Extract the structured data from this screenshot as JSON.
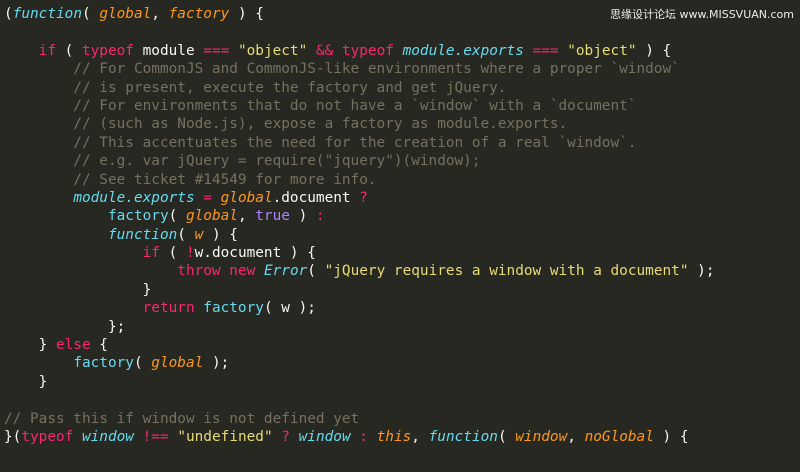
{
  "watermark": "思缘设计论坛 www.MISSVUAN.com",
  "lines": [
    [
      {
        "t": "(",
        "c": "plain"
      },
      {
        "t": "function",
        "c": "fn"
      },
      {
        "t": "( ",
        "c": "plain"
      },
      {
        "t": "global",
        "c": "param"
      },
      {
        "t": ", ",
        "c": "plain"
      },
      {
        "t": "factory",
        "c": "param"
      },
      {
        "t": " ) {",
        "c": "plain"
      }
    ],
    [],
    [
      {
        "t": "    ",
        "c": "plain"
      },
      {
        "t": "if",
        "c": "kw"
      },
      {
        "t": " ( ",
        "c": "plain"
      },
      {
        "t": "typeof",
        "c": "kw"
      },
      {
        "t": " module ",
        "c": "plain"
      },
      {
        "t": "===",
        "c": "op"
      },
      {
        "t": " ",
        "c": "plain"
      },
      {
        "t": "\"object\"",
        "c": "str"
      },
      {
        "t": " ",
        "c": "plain"
      },
      {
        "t": "&&",
        "c": "op"
      },
      {
        "t": " ",
        "c": "plain"
      },
      {
        "t": "typeof",
        "c": "kw"
      },
      {
        "t": " ",
        "c": "plain"
      },
      {
        "t": "module.exports",
        "c": "fn"
      },
      {
        "t": " ",
        "c": "plain"
      },
      {
        "t": "===",
        "c": "op"
      },
      {
        "t": " ",
        "c": "plain"
      },
      {
        "t": "\"object\"",
        "c": "str"
      },
      {
        "t": " ) {",
        "c": "plain"
      }
    ],
    [
      {
        "t": "        // For CommonJS and CommonJS-like environments where a proper `window`",
        "c": "cmt"
      }
    ],
    [
      {
        "t": "        // is present, execute the factory and get jQuery.",
        "c": "cmt"
      }
    ],
    [
      {
        "t": "        // For environments that do not have a `window` with a `document`",
        "c": "cmt"
      }
    ],
    [
      {
        "t": "        // (such as Node.js), expose a factory as module.exports.",
        "c": "cmt"
      }
    ],
    [
      {
        "t": "        // This accentuates the need for the creation of a real `window`.",
        "c": "cmt"
      }
    ],
    [
      {
        "t": "        // e.g. var jQuery = require(\"jquery\")(window);",
        "c": "cmt"
      }
    ],
    [
      {
        "t": "        // See ticket #14549 for more info.",
        "c": "cmt"
      }
    ],
    [
      {
        "t": "        ",
        "c": "plain"
      },
      {
        "t": "module.exports",
        "c": "fn"
      },
      {
        "t": " ",
        "c": "plain"
      },
      {
        "t": "=",
        "c": "op"
      },
      {
        "t": " ",
        "c": "plain"
      },
      {
        "t": "global",
        "c": "param"
      },
      {
        "t": ".document ",
        "c": "plain"
      },
      {
        "t": "?",
        "c": "op"
      }
    ],
    [
      {
        "t": "            ",
        "c": "plain"
      },
      {
        "t": "factory",
        "c": "call"
      },
      {
        "t": "( ",
        "c": "plain"
      },
      {
        "t": "global",
        "c": "param"
      },
      {
        "t": ", ",
        "c": "plain"
      },
      {
        "t": "true",
        "c": "bool"
      },
      {
        "t": " ) ",
        "c": "plain"
      },
      {
        "t": ":",
        "c": "op"
      }
    ],
    [
      {
        "t": "            ",
        "c": "plain"
      },
      {
        "t": "function",
        "c": "fn"
      },
      {
        "t": "( ",
        "c": "plain"
      },
      {
        "t": "w",
        "c": "param"
      },
      {
        "t": " ) {",
        "c": "plain"
      }
    ],
    [
      {
        "t": "                ",
        "c": "plain"
      },
      {
        "t": "if",
        "c": "kw"
      },
      {
        "t": " ( ",
        "c": "plain"
      },
      {
        "t": "!",
        "c": "op"
      },
      {
        "t": "w.document ) {",
        "c": "plain"
      }
    ],
    [
      {
        "t": "                    ",
        "c": "plain"
      },
      {
        "t": "throw",
        "c": "kw"
      },
      {
        "t": " ",
        "c": "plain"
      },
      {
        "t": "new",
        "c": "kw"
      },
      {
        "t": " ",
        "c": "plain"
      },
      {
        "t": "Error",
        "c": "cls"
      },
      {
        "t": "( ",
        "c": "plain"
      },
      {
        "t": "\"jQuery requires a window with a document\"",
        "c": "str"
      },
      {
        "t": " );",
        "c": "plain"
      }
    ],
    [
      {
        "t": "                }",
        "c": "plain"
      }
    ],
    [
      {
        "t": "                ",
        "c": "plain"
      },
      {
        "t": "return",
        "c": "kw"
      },
      {
        "t": " ",
        "c": "plain"
      },
      {
        "t": "factory",
        "c": "call"
      },
      {
        "t": "( w );",
        "c": "plain"
      }
    ],
    [
      {
        "t": "            };",
        "c": "plain"
      }
    ],
    [
      {
        "t": "    } ",
        "c": "plain"
      },
      {
        "t": "else",
        "c": "kw"
      },
      {
        "t": " {",
        "c": "plain"
      }
    ],
    [
      {
        "t": "        ",
        "c": "plain"
      },
      {
        "t": "factory",
        "c": "call"
      },
      {
        "t": "( ",
        "c": "plain"
      },
      {
        "t": "global",
        "c": "param"
      },
      {
        "t": " );",
        "c": "plain"
      }
    ],
    [
      {
        "t": "    }",
        "c": "plain"
      }
    ],
    [],
    [
      {
        "t": "// Pass this if window is not defined yet",
        "c": "cmt"
      }
    ],
    [
      {
        "t": "}(",
        "c": "plain"
      },
      {
        "t": "typeof",
        "c": "kw"
      },
      {
        "t": " ",
        "c": "plain"
      },
      {
        "t": "window",
        "c": "fn"
      },
      {
        "t": " ",
        "c": "plain"
      },
      {
        "t": "!==",
        "c": "op"
      },
      {
        "t": " ",
        "c": "plain"
      },
      {
        "t": "\"undefined\"",
        "c": "str"
      },
      {
        "t": " ",
        "c": "plain"
      },
      {
        "t": "?",
        "c": "op"
      },
      {
        "t": " ",
        "c": "plain"
      },
      {
        "t": "window",
        "c": "fn"
      },
      {
        "t": " ",
        "c": "plain"
      },
      {
        "t": ":",
        "c": "op"
      },
      {
        "t": " ",
        "c": "plain"
      },
      {
        "t": "this",
        "c": "this"
      },
      {
        "t": ", ",
        "c": "plain"
      },
      {
        "t": "function",
        "c": "fn"
      },
      {
        "t": "( ",
        "c": "plain"
      },
      {
        "t": "window",
        "c": "param"
      },
      {
        "t": ", ",
        "c": "plain"
      },
      {
        "t": "noGlobal",
        "c": "param"
      },
      {
        "t": " ) {",
        "c": "plain"
      }
    ]
  ]
}
